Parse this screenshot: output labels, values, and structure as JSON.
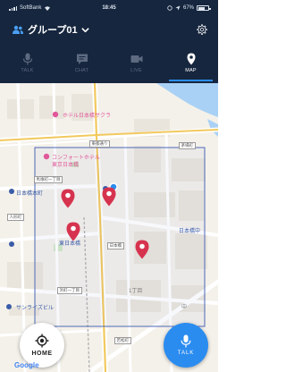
{
  "status_bar": {
    "carrier": "SoftBank",
    "time": "18:45",
    "battery": "67%",
    "battery_level": 0.67
  },
  "header": {
    "title": "グループ01",
    "group_icon": "group-icon",
    "dropdown_icon": "chevron-down-icon",
    "settings_icon": "gear-icon"
  },
  "tabs": [
    {
      "label": "TALK",
      "icon": "microphone-icon",
      "active": false
    },
    {
      "label": "CHAT",
      "icon": "chat-bubble-icon",
      "active": false
    },
    {
      "label": "LIVE",
      "icon": "video-camera-icon",
      "active": false
    },
    {
      "label": "MAP",
      "icon": "map-pin-icon",
      "active": true
    }
  ],
  "map": {
    "poi_labels": [
      "ホテル日本橋サクラ",
      "コンフォートホテル",
      "東京日本橋",
      "日本橋本町",
      "東日本橋",
      "日本橋中",
      "サンライズビル",
      "1丁目",
      "中"
    ],
    "route_labels": [
      "東都通り",
      "馬喰町一丁目",
      "茅場町",
      "日本橋",
      "人形町",
      "浜町一丁目",
      "若松町"
    ],
    "logo_text": "Google"
  },
  "home_button": {
    "label": "HOME",
    "icon": "crosshair-icon"
  },
  "talk_button": {
    "label": "TALK",
    "icon": "microphone-icon"
  },
  "colors": {
    "header_bg": "#16263e",
    "accent": "#2b8cf0",
    "pin": "#d6334f",
    "inactive_tab": "#5d6a80"
  }
}
